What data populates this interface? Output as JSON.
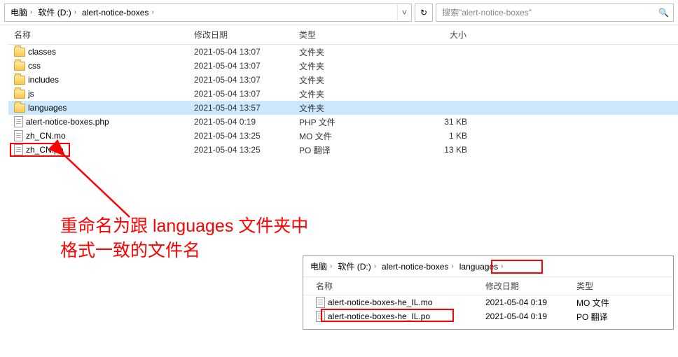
{
  "toolbar": {
    "crumbs": [
      "电脑",
      "软件 (D:)",
      "alert-notice-boxes"
    ],
    "search_placeholder": "搜索\"alert-notice-boxes\""
  },
  "headers": {
    "name": "名称",
    "date": "修改日期",
    "type": "类型",
    "size": "大小"
  },
  "rows": [
    {
      "name": "classes",
      "date": "2021-05-04 13:07",
      "type": "文件夹",
      "size": "",
      "icon": "folder",
      "selected": false
    },
    {
      "name": "css",
      "date": "2021-05-04 13:07",
      "type": "文件夹",
      "size": "",
      "icon": "folder",
      "selected": false
    },
    {
      "name": "includes",
      "date": "2021-05-04 13:07",
      "type": "文件夹",
      "size": "",
      "icon": "folder",
      "selected": false
    },
    {
      "name": "js",
      "date": "2021-05-04 13:07",
      "type": "文件夹",
      "size": "",
      "icon": "folder",
      "selected": false
    },
    {
      "name": "languages",
      "date": "2021-05-04 13:57",
      "type": "文件夹",
      "size": "",
      "icon": "folder",
      "selected": true
    },
    {
      "name": "alert-notice-boxes.php",
      "date": "2021-05-04 0:19",
      "type": "PHP 文件",
      "size": "31 KB",
      "icon": "file",
      "selected": false
    },
    {
      "name": "zh_CN.mo",
      "date": "2021-05-04 13:25",
      "type": "MO 文件",
      "size": "1 KB",
      "icon": "file",
      "selected": false
    },
    {
      "name": "zh_CN.po",
      "date": "2021-05-04 13:25",
      "type": "PO 翻译",
      "size": "13 KB",
      "icon": "file",
      "selected": false
    }
  ],
  "annotation": {
    "line1": "重命名为跟 languages 文件夹中",
    "line2": "格式一致的文件名"
  },
  "sub": {
    "crumbs": [
      "电脑",
      "软件 (D:)",
      "alert-notice-boxes",
      "languages"
    ],
    "headers": {
      "name": "名称",
      "date": "修改日期",
      "type": "类型"
    },
    "rows": [
      {
        "name": "alert-notice-boxes-he_IL.mo",
        "date": "2021-05-04 0:19",
        "type": "MO 文件",
        "icon": "file"
      },
      {
        "name": "alert-notice-boxes-he_IL.po",
        "date": "2021-05-04 0:19",
        "type": "PO 翻译",
        "icon": "file"
      }
    ]
  }
}
